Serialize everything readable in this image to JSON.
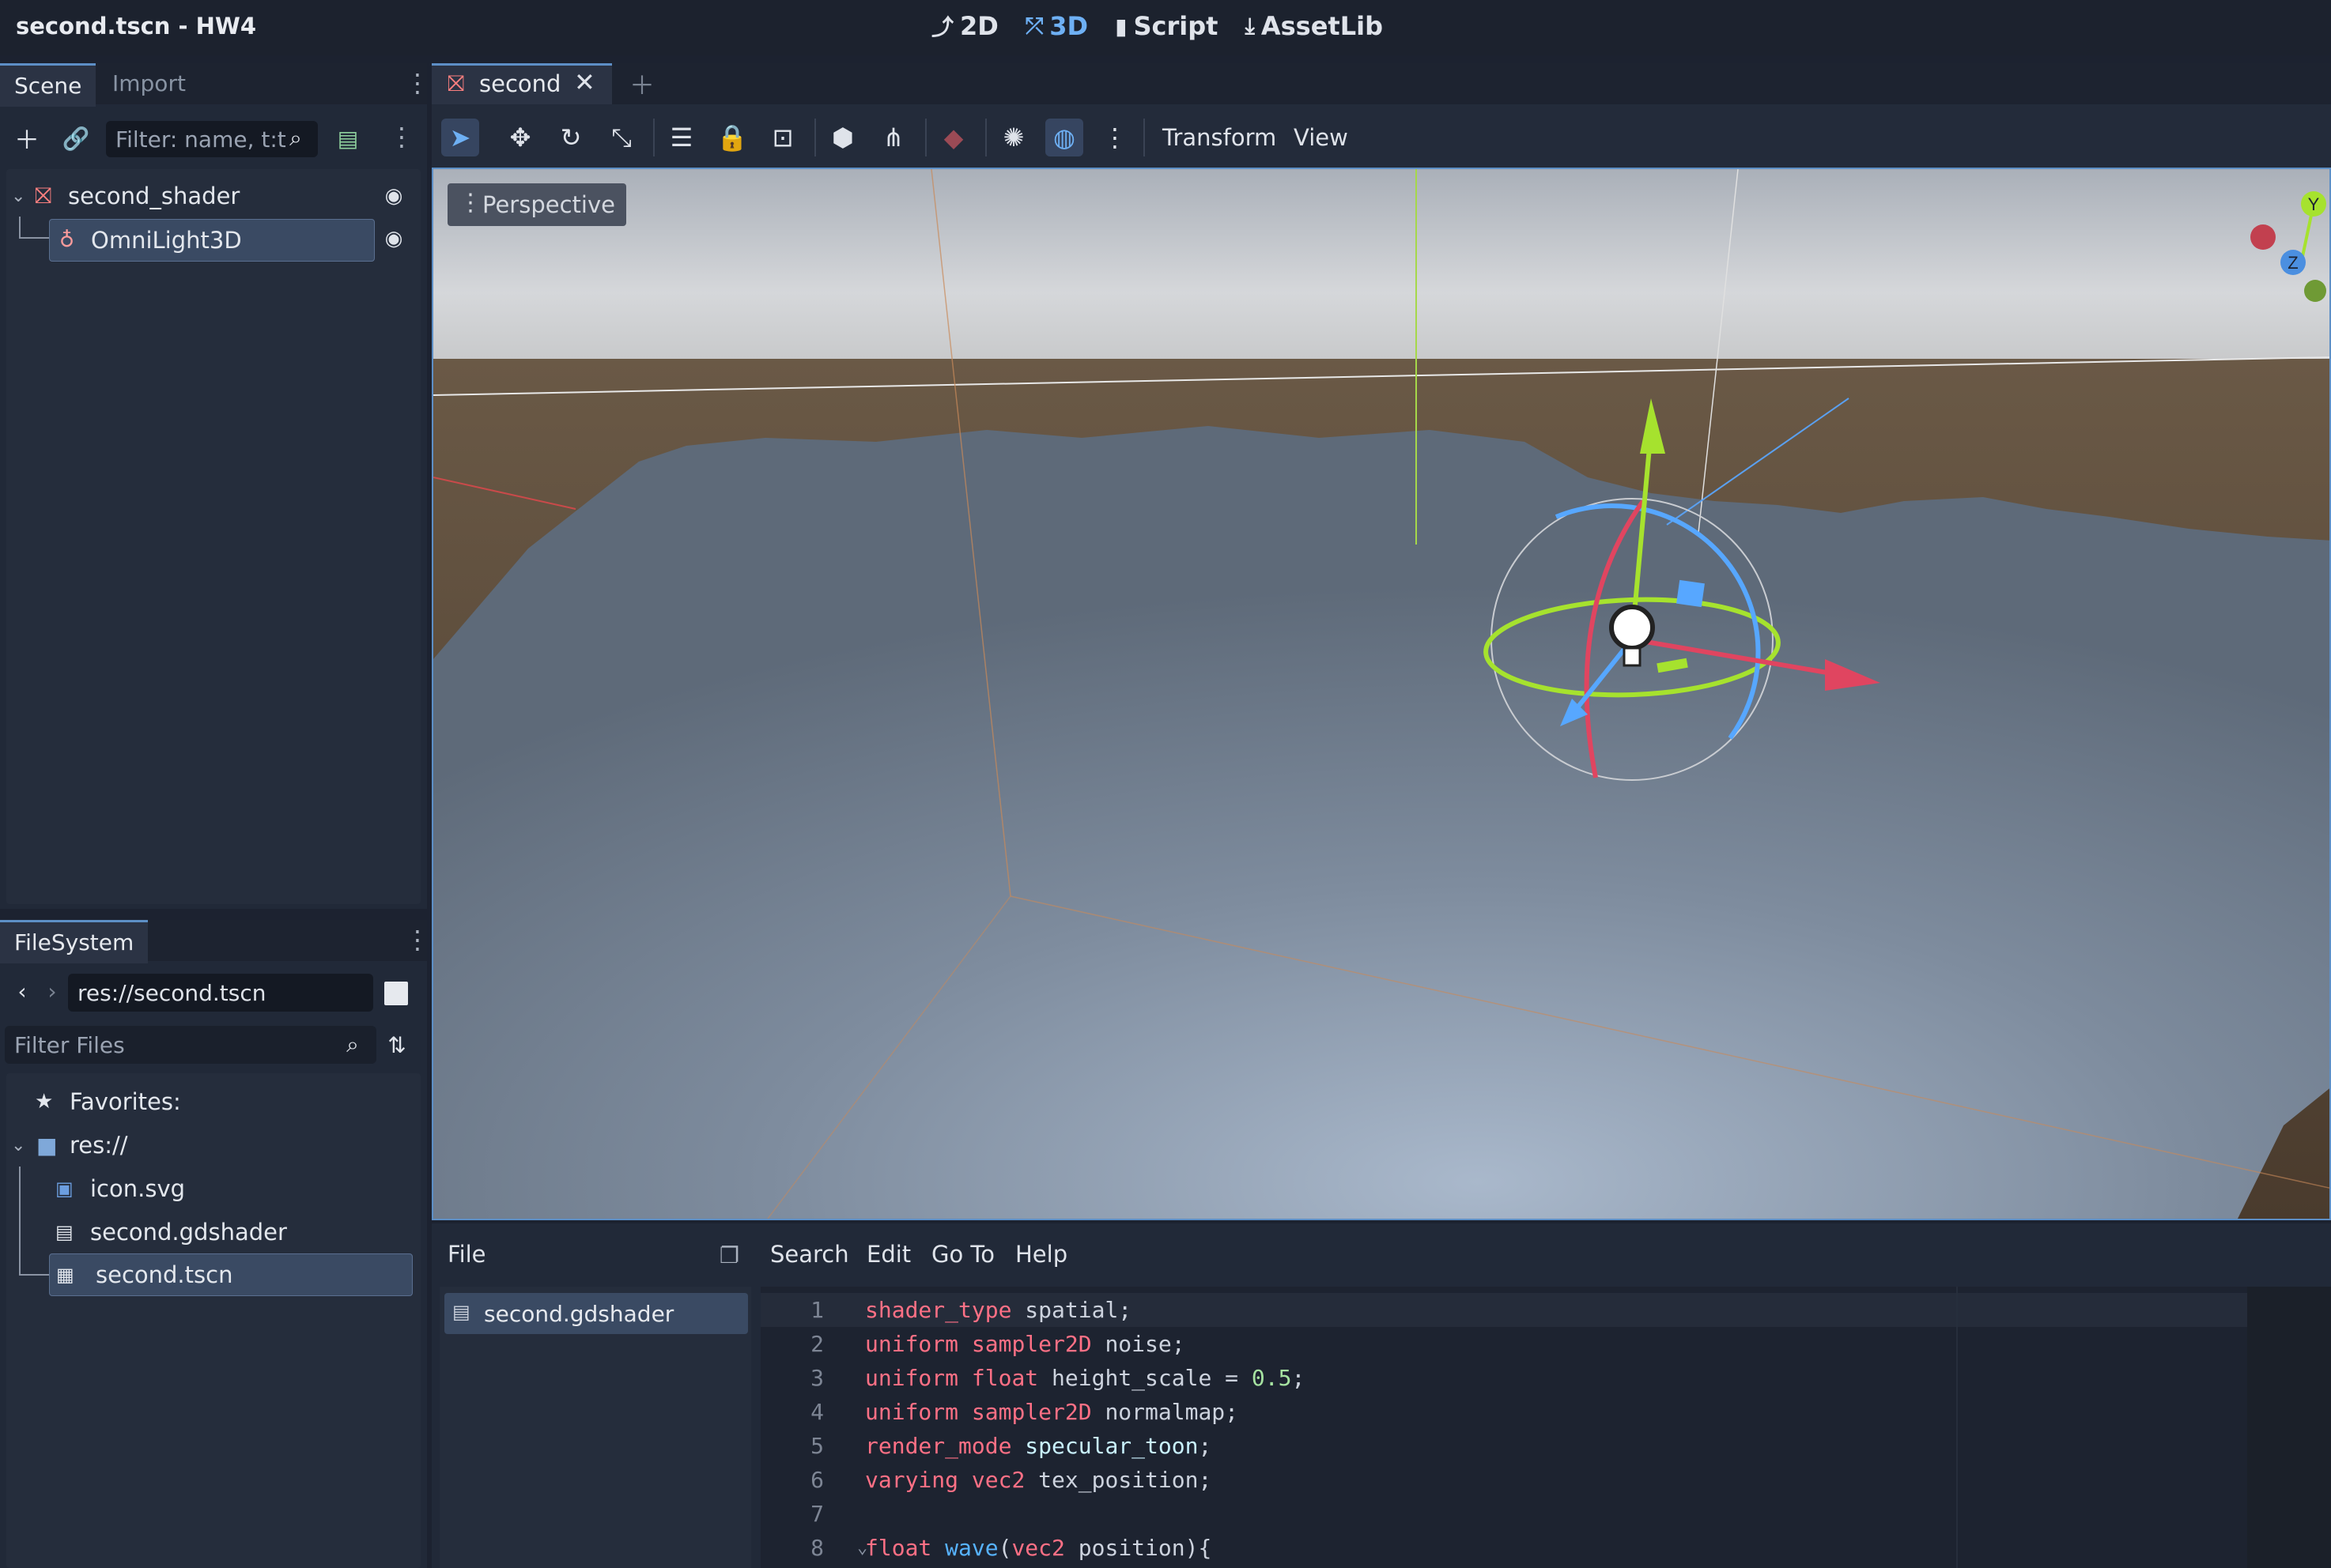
{
  "window": {
    "title": "second.tscn - HW4"
  },
  "main_nav": [
    {
      "label": "2D",
      "icon": "2d-icon"
    },
    {
      "label": "3D",
      "icon": "3d-icon",
      "active": true
    },
    {
      "label": "Script",
      "icon": "script-icon"
    },
    {
      "label": "AssetLib",
      "icon": "assetlib-icon"
    }
  ],
  "scene_dock": {
    "tabs": [
      "Scene",
      "Import"
    ],
    "filter_placeholder": "Filter: name, t:t",
    "tree": [
      {
        "label": "second_shader",
        "icon": "node3d-icon",
        "visible": true
      },
      {
        "label": "OmniLight3D",
        "icon": "omnilight-icon",
        "visible": true,
        "selected": true
      }
    ]
  },
  "filesystem_dock": {
    "tab": "FileSystem",
    "path": "res://second.tscn",
    "filter_placeholder": "Filter Files",
    "tree": [
      {
        "label": "Favorites:",
        "icon": "star-icon"
      },
      {
        "label": "res://",
        "icon": "folder-icon"
      },
      {
        "label": "icon.svg",
        "icon": "image-icon"
      },
      {
        "label": "second.gdshader",
        "icon": "shader-file-icon"
      },
      {
        "label": "second.tscn",
        "icon": "scene-file-icon",
        "selected": true
      }
    ]
  },
  "editor": {
    "scene_tab": "second",
    "toolbar_menus": [
      "Transform",
      "View"
    ],
    "viewport_label": "Perspective",
    "gizmo_axes": [
      "Y",
      "Z"
    ]
  },
  "script_editor": {
    "menus": [
      "File",
      "Search",
      "Edit",
      "Go To",
      "Help"
    ],
    "open_files": [
      "second.gdshader"
    ],
    "lines": [
      {
        "n": "1",
        "parts": [
          [
            "kw",
            "shader_type"
          ],
          [
            "pl",
            " spatial;"
          ]
        ]
      },
      {
        "n": "2",
        "parts": [
          [
            "kw",
            "uniform"
          ],
          [
            "pl",
            " "
          ],
          [
            "ty",
            "sampler2D"
          ],
          [
            "pl",
            " noise;"
          ]
        ]
      },
      {
        "n": "3",
        "parts": [
          [
            "kw",
            "uniform"
          ],
          [
            "pl",
            " "
          ],
          [
            "ty",
            "float"
          ],
          [
            "pl",
            " height_scale = "
          ],
          [
            "num",
            "0.5"
          ],
          [
            "pl",
            ";"
          ]
        ]
      },
      {
        "n": "4",
        "parts": [
          [
            "kw",
            "uniform"
          ],
          [
            "pl",
            " "
          ],
          [
            "ty",
            "sampler2D"
          ],
          [
            "pl",
            " normalmap;"
          ]
        ]
      },
      {
        "n": "5",
        "parts": [
          [
            "kw",
            "render_mode"
          ],
          [
            "pl",
            " "
          ],
          [
            "hint",
            "specular_toon"
          ],
          [
            "pl",
            ";"
          ]
        ]
      },
      {
        "n": "6",
        "parts": [
          [
            "kw",
            "varying"
          ],
          [
            "pl",
            " "
          ],
          [
            "ty",
            "vec2"
          ],
          [
            "pl",
            " tex_position;"
          ]
        ]
      },
      {
        "n": "7",
        "parts": []
      },
      {
        "n": "8",
        "parts": [
          [
            "ty",
            "float"
          ],
          [
            "pl",
            " "
          ],
          [
            "fn",
            "wave"
          ],
          [
            "pl",
            "("
          ],
          [
            "ty",
            "vec2"
          ],
          [
            "pl",
            " position){"
          ]
        ]
      }
    ]
  }
}
